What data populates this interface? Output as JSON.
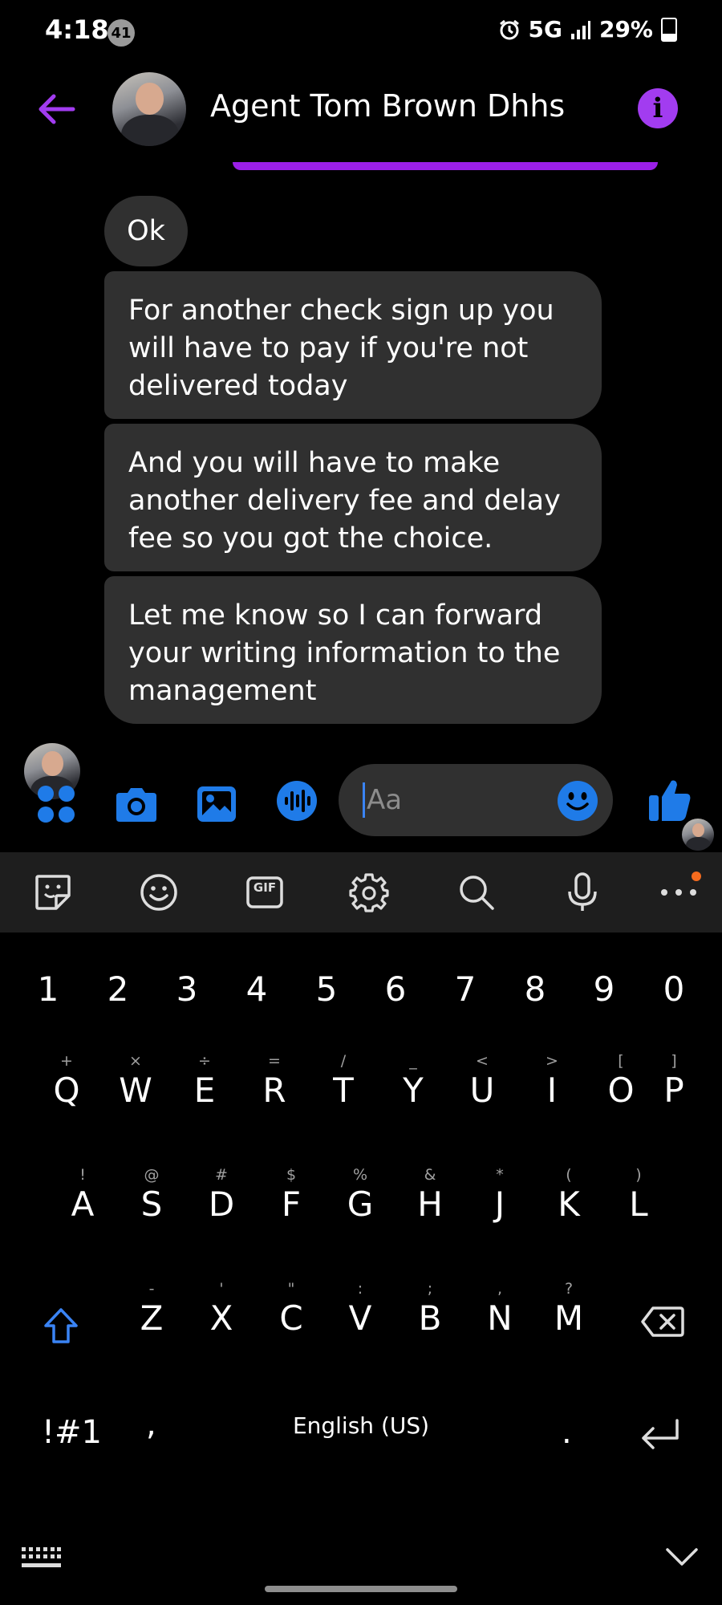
{
  "status_bar": {
    "time": "4:18",
    "notification_count": "41",
    "network": "5G",
    "battery": "29%"
  },
  "header": {
    "contact_name": "Agent Tom Brown Dhhs",
    "info_icon": "i"
  },
  "messages": [
    {
      "text": "Ok"
    },
    {
      "text": "For another check sign up you will have to pay if you're not delivered today"
    },
    {
      "text": "And you will have to make another delivery fee and delay fee so you got the choice."
    },
    {
      "text": "Let me know so I can forward your writing information to the management"
    }
  ],
  "composer": {
    "placeholder": "Aa"
  },
  "keyboard": {
    "toolbar": [
      "sticker-icon",
      "emoji-icon",
      "gif-icon",
      "settings-icon",
      "search-icon",
      "mic-icon",
      "more-icon"
    ],
    "gif_label": "GIF",
    "numbers": [
      "1",
      "2",
      "3",
      "4",
      "5",
      "6",
      "7",
      "8",
      "9",
      "0"
    ],
    "row1": [
      {
        "k": "Q",
        "h": "+"
      },
      {
        "k": "W",
        "h": "×"
      },
      {
        "k": "E",
        "h": "÷"
      },
      {
        "k": "R",
        "h": "="
      },
      {
        "k": "T",
        "h": "/"
      },
      {
        "k": "Y",
        "h": "_"
      },
      {
        "k": "U",
        "h": "<"
      },
      {
        "k": "I",
        "h": ">"
      },
      {
        "k": "O",
        "h": "["
      },
      {
        "k": "P",
        "h": "]"
      }
    ],
    "row2": [
      {
        "k": "A",
        "h": "!"
      },
      {
        "k": "S",
        "h": "@"
      },
      {
        "k": "D",
        "h": "#"
      },
      {
        "k": "F",
        "h": "$"
      },
      {
        "k": "G",
        "h": "%"
      },
      {
        "k": "H",
        "h": "&"
      },
      {
        "k": "J",
        "h": "*"
      },
      {
        "k": "K",
        "h": "("
      },
      {
        "k": "L",
        "h": ")"
      }
    ],
    "row3": [
      {
        "k": "Z",
        "h": "-"
      },
      {
        "k": "X",
        "h": "'"
      },
      {
        "k": "C",
        "h": "\""
      },
      {
        "k": "V",
        "h": ":"
      },
      {
        "k": "B",
        "h": ";"
      },
      {
        "k": "N",
        "h": ","
      },
      {
        "k": "M",
        "h": "?"
      }
    ],
    "symbols_key": "!#1",
    "comma_key": ",",
    "space_label": "English (US)",
    "period_key": "."
  },
  "colors": {
    "accent_purple": "#a23cf0",
    "messenger_blue": "#1f7be8",
    "bubble": "#303030"
  }
}
